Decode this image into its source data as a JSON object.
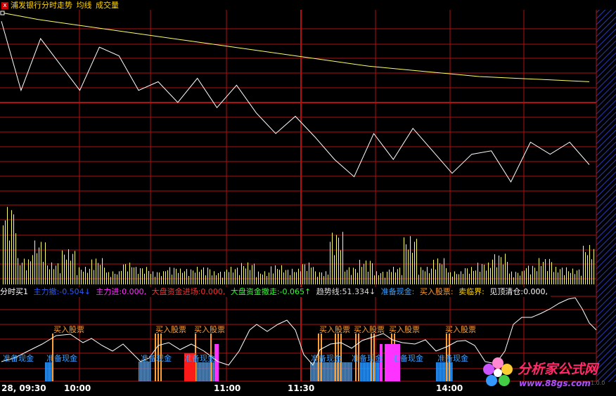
{
  "title_bar": {
    "close_glyph": "x",
    "title": "浦发银行分时走势",
    "ma_label": "均线",
    "vol_label": "成交量"
  },
  "indicator_bar": {
    "name": "分时买1",
    "items": [
      {
        "label": "主力撤:",
        "value": "-0.504",
        "arrow": "↓",
        "color": "#2a58ff"
      },
      {
        "label": "主力进:",
        "value": "0.000,",
        "arrow": "",
        "color": "#ff33ff"
      },
      {
        "label": "大盘资金进场:",
        "value": "0.000,",
        "arrow": "",
        "color": "#ff3030"
      },
      {
        "label": "大盘资金撤走:",
        "value": "-0.065",
        "arrow": "↑",
        "color": "#33ff33"
      },
      {
        "label": "趋势线:",
        "value": "51.334",
        "arrow": "↓",
        "color": "#dddddd"
      },
      {
        "label": "准备现金:",
        "value": "",
        "arrow": "",
        "color": "#3aa0ff"
      },
      {
        "label": "买入股票:",
        "value": "",
        "arrow": "",
        "color": "#ffa033"
      },
      {
        "label": "卖临界:",
        "value": "",
        "arrow": "",
        "color": "#ffd700"
      },
      {
        "label": "见顶清仓:",
        "value": "0.000,",
        "arrow": "",
        "color": "#ffffff"
      }
    ]
  },
  "signals": {
    "buy_label": "买入股票",
    "cash_label": "准备现金",
    "buy_color": "#ffa033",
    "cash_color": "#3aa0ff"
  },
  "time_axis": [
    "28, 09:30",
    "10:00",
    "11:00",
    "11:30",
    "14:00"
  ],
  "watermark": {
    "cn": "分析家公式网",
    "url": "www.88gs.com",
    "ver": "1.0.0"
  },
  "colors": {
    "background": "#000000",
    "grid": "#b01010",
    "price_line": "#ffffff",
    "avg_line": "#ffff66",
    "volume": "#ffff66",
    "trend_line": "#ffffff",
    "cash_bar": "#3aa0ff",
    "buy_bar": "#ffa033",
    "main_in_bar": "#ff33ff",
    "big_in_bar": "#ff1a1a",
    "hatch": "#2b3bb0"
  },
  "chart_data": [
    {
      "type": "line",
      "title": "浦发银行分时走势",
      "series": [
        {
          "name": "均线",
          "values": [
            1.0,
            0.96,
            0.93,
            0.9,
            0.87,
            0.84,
            0.81,
            0.78,
            0.75,
            0.72,
            0.69,
            0.67,
            0.65,
            0.63,
            0.62,
            0.61,
            0.6
          ]
        }
      ],
      "price_values": [
        0.95,
        0.55,
        0.85,
        0.7,
        0.55,
        0.8,
        0.75,
        0.55,
        0.6,
        0.48,
        0.62,
        0.45,
        0.58,
        0.42,
        0.3,
        0.4,
        0.28,
        0.15,
        0.05,
        0.3,
        0.15,
        0.33,
        0.2,
        0.07,
        0.18,
        0.2,
        0.02,
        0.25,
        0.18,
        0.25,
        0.12
      ]
    },
    {
      "type": "bar",
      "title": "成交量",
      "values": [
        0.9,
        0.3,
        0.5,
        0.25,
        0.4,
        0.2,
        0.3,
        0.15,
        0.25,
        0.2,
        0.15,
        0.2,
        0.18,
        0.2,
        0.15,
        0.2,
        0.25,
        0.15,
        0.22,
        0.18,
        0.25,
        0.15,
        0.6,
        0.2,
        0.28,
        0.15,
        0.2,
        0.55,
        0.2,
        0.3,
        0.15,
        0.2,
        0.25,
        0.35,
        0.15,
        0.22,
        0.3,
        0.2,
        0.18,
        0.45
      ]
    }
  ]
}
